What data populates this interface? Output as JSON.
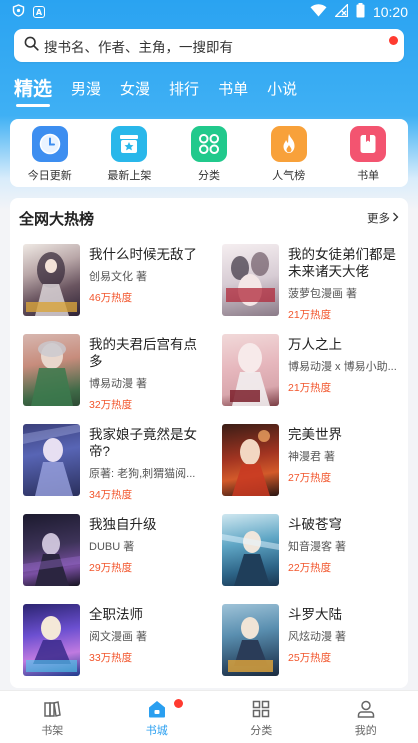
{
  "status_bar": {
    "time": "10:20",
    "icons": [
      "shield-icon",
      "a-icon",
      "wifi-icon",
      "no-signal-icon",
      "battery-icon"
    ],
    "left_icon_text": "A"
  },
  "search": {
    "placeholder": "搜书名、作者、主角，一搜即有",
    "icon": "search-icon"
  },
  "top_tabs": [
    {
      "label": "精选",
      "active": true
    },
    {
      "label": "男漫",
      "active": false
    },
    {
      "label": "女漫",
      "active": false
    },
    {
      "label": "排行",
      "active": false
    },
    {
      "label": "书单",
      "active": false
    },
    {
      "label": "小说",
      "active": false
    }
  ],
  "quick_links": [
    {
      "label": "今日更新",
      "icon": "clock-icon",
      "color": "#3d8ef0"
    },
    {
      "label": "最新上架",
      "icon": "star-tray-icon",
      "color": "#29b7ea"
    },
    {
      "label": "分类",
      "icon": "grid-icon",
      "color": "#21c98c"
    },
    {
      "label": "人气榜",
      "icon": "flame-icon",
      "color": "#f8a13a"
    },
    {
      "label": "书单",
      "icon": "booklist-icon",
      "color": "#f35470"
    }
  ],
  "ranking": {
    "title": "全网大热榜",
    "more_label": "更多",
    "books": [
      {
        "title": "我什么时候无敌了",
        "author": "创易文化 著",
        "heat": "46万热度"
      },
      {
        "title": "我的女徒弟们都是未来诸天大佬",
        "author": "菠萝包漫画 著",
        "heat": "21万热度"
      },
      {
        "title": "我的夫君后宫有点多",
        "author": "博易动漫 著",
        "heat": "32万热度"
      },
      {
        "title": "万人之上",
        "author": "博易动漫 x 博易小助...",
        "heat": "21万热度"
      },
      {
        "title": "我家娘子竟然是女帝?",
        "author": "原著: 老狗,刺猬猫阅...",
        "heat": "34万热度"
      },
      {
        "title": "完美世界",
        "author": "神漫君 著",
        "heat": "27万热度"
      },
      {
        "title": "我独自升级",
        "author": "DUBU 著",
        "heat": "29万热度"
      },
      {
        "title": "斗破苍穹",
        "author": "知音漫客 著",
        "heat": "22万热度"
      },
      {
        "title": "全职法师",
        "author": "阅文漫画 著",
        "heat": "33万热度"
      },
      {
        "title": "斗罗大陆",
        "author": "风炫动漫 著",
        "heat": "25万热度"
      }
    ]
  },
  "bottom_nav": [
    {
      "label": "书架",
      "icon": "bookshelf-icon",
      "active": false
    },
    {
      "label": "书城",
      "icon": "home-icon",
      "active": true
    },
    {
      "label": "分类",
      "icon": "category-icon",
      "active": false
    },
    {
      "label": "我的",
      "icon": "user-icon",
      "active": false
    }
  ],
  "colors": {
    "accent": "#2a9ff0",
    "heat": "#f2552c",
    "badge": "#ff3b30"
  }
}
